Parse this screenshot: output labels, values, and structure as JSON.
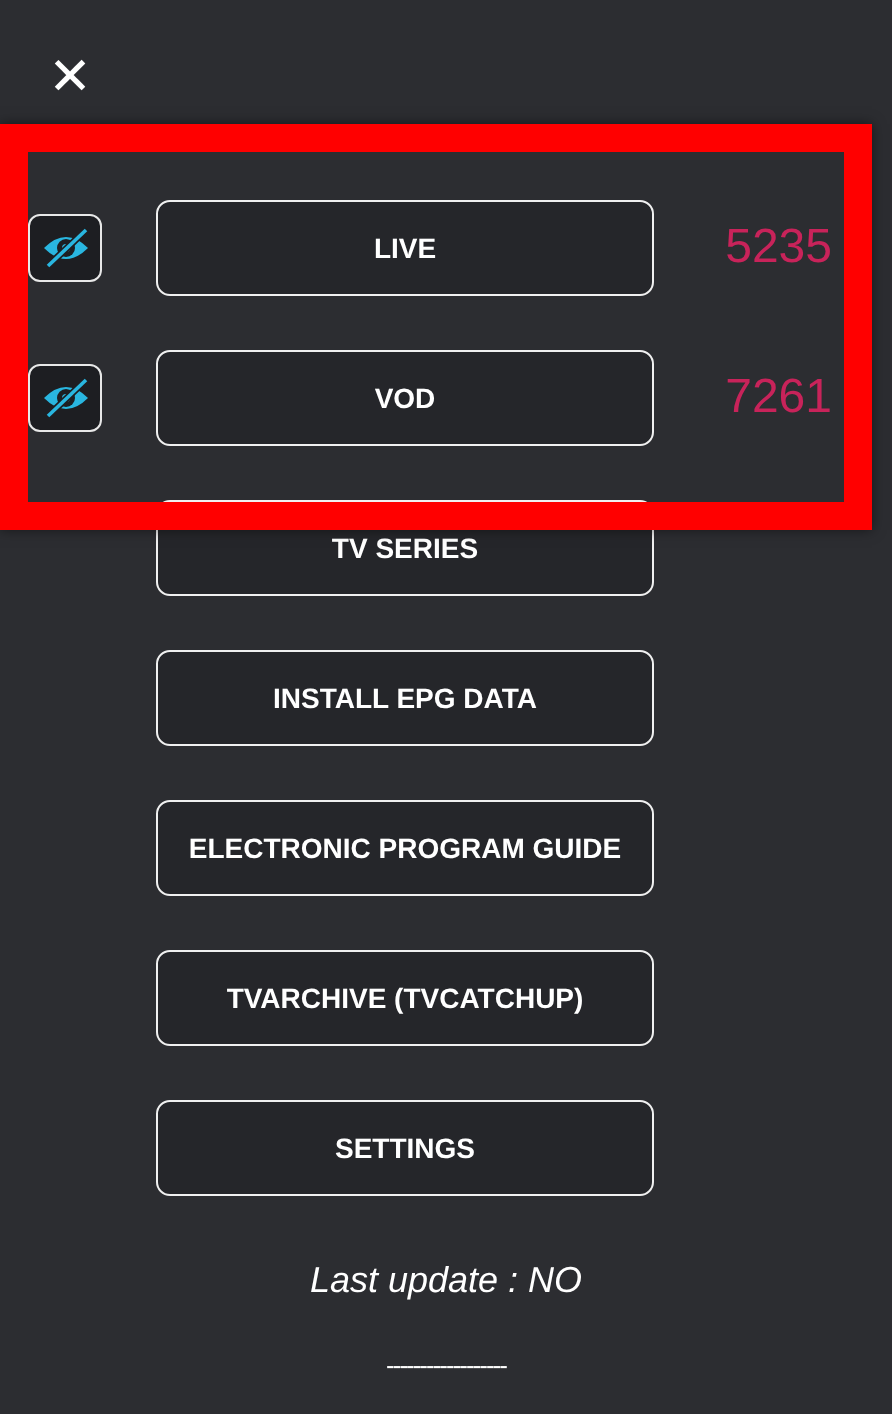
{
  "close": {
    "label": "✕"
  },
  "menu": [
    {
      "label": "LIVE",
      "eye_toggle": true,
      "count": "5235"
    },
    {
      "label": "VOD",
      "eye_toggle": true,
      "count": "7261"
    },
    {
      "label": "TV SERIES",
      "eye_toggle": false
    },
    {
      "label": "INSTALL EPG DATA",
      "eye_toggle": false
    },
    {
      "label": "ELECTRONIC PROGRAM GUIDE",
      "eye_toggle": false
    },
    {
      "label": "TVARCHIVE (TVCATCHUP)",
      "eye_toggle": false
    },
    {
      "label": "SETTINGS",
      "eye_toggle": false
    }
  ],
  "last_update": "Last update : NO",
  "footer_rule": "------------------",
  "highlight": true
}
